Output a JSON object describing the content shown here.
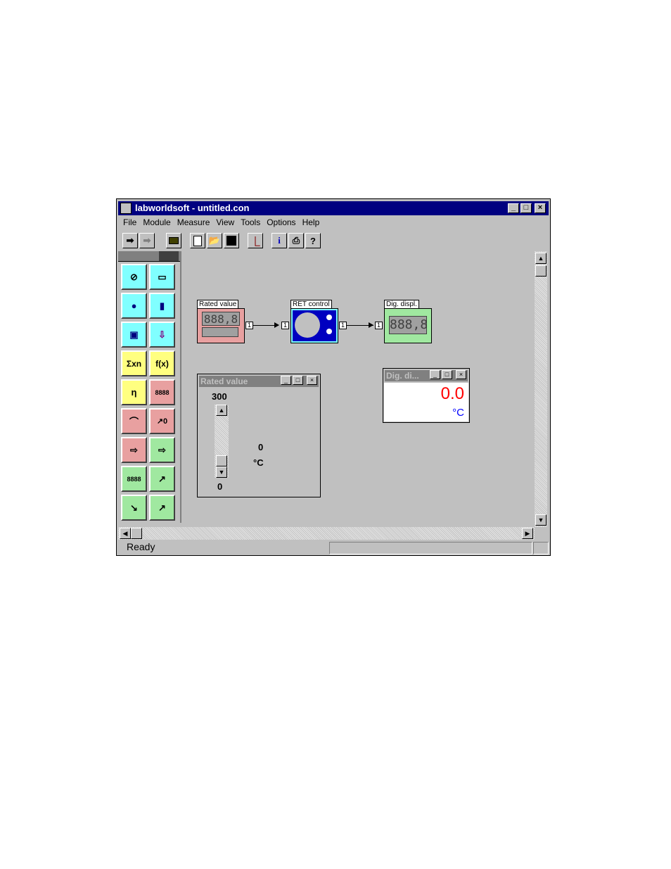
{
  "window": {
    "title": "labworldsoft - untitled.con"
  },
  "menu": [
    "File",
    "Module",
    "Measure",
    "View",
    "Tools",
    "Options",
    "Help"
  ],
  "toolbar": {
    "info_glyph": "i",
    "help_glyph": "?"
  },
  "palette": {
    "sum_label": "Σxn",
    "fx_label": "f(x)",
    "digits_label": "8888",
    "digits_label2": "8888"
  },
  "diagram": {
    "rated_value": {
      "label": "Rated value",
      "lcd": "888,8",
      "port_out": "1"
    },
    "ret_control": {
      "label": "RET control",
      "port_in": "1",
      "port_out": "1"
    },
    "dig_displ": {
      "label": "Dig. displ.",
      "lcd": "888,8",
      "port_in": "1"
    }
  },
  "rated_window": {
    "title": "Rated value",
    "max": "300",
    "min": "0",
    "value": "0",
    "unit": "°C"
  },
  "dig_window": {
    "title": "Dig. di...",
    "value": "0.0",
    "unit": "°C",
    "value_color": "#ff0000",
    "unit_color": "#0000ff"
  },
  "status": {
    "text": "Ready"
  },
  "colors": {
    "titlebar": "#000080",
    "module_red": "#e8a0a0",
    "module_cyan": "#80ffff",
    "module_green": "#a0e8a0"
  }
}
